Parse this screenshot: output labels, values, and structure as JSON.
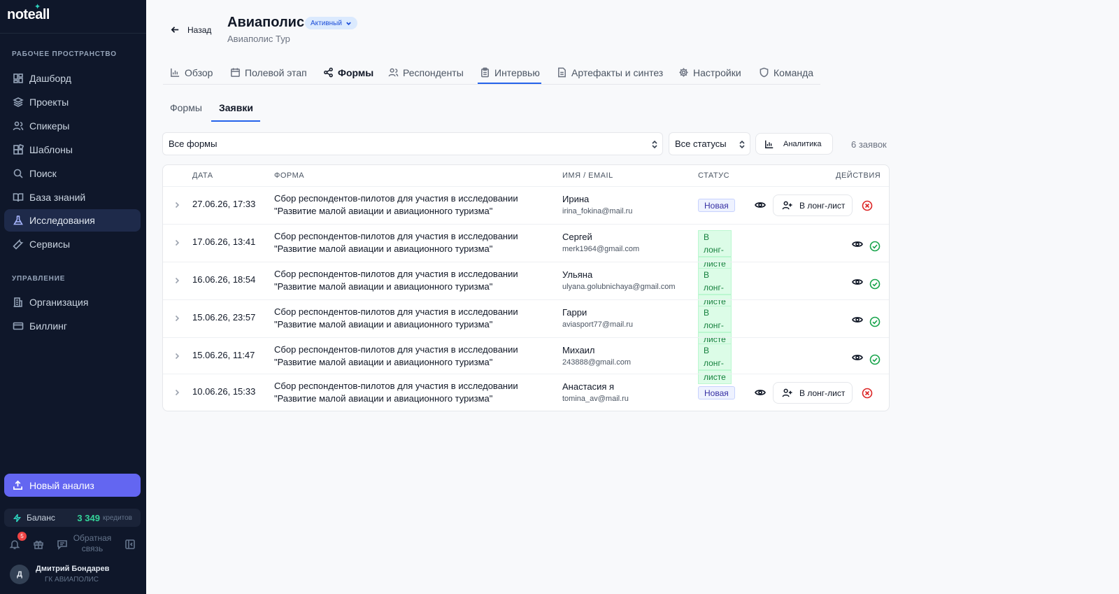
{
  "app": {
    "logo": "noteall"
  },
  "sidebar": {
    "section_workspace": "РАБОЧЕЕ ПРОСТРАНСТВО",
    "section_manage": "УПРАВЛЕНИЕ",
    "items": [
      {
        "label": "Дашборд",
        "icon": "dashboard-icon"
      },
      {
        "label": "Проекты",
        "icon": "layers-icon"
      },
      {
        "label": "Спикеры",
        "icon": "users-icon"
      },
      {
        "label": "Шаблоны",
        "icon": "blocks-icon"
      },
      {
        "label": "Поиск",
        "icon": "search-icon"
      },
      {
        "label": "База знаний",
        "icon": "book-icon"
      },
      {
        "label": "Исследования",
        "icon": "flask-icon"
      },
      {
        "label": "Сервисы",
        "icon": "wrench-icon"
      }
    ],
    "manage_items": [
      {
        "label": "Организация",
        "icon": "building-icon"
      },
      {
        "label": "Биллинг",
        "icon": "card-icon"
      }
    ],
    "new_analysis": "Новый анализ",
    "balance_label": "Баланс",
    "balance_amount": "3 349",
    "balance_unit": "кредитов",
    "notifications_count": "5",
    "feedback": "Обратная связь",
    "user_initial": "Д",
    "user_name": "Дмитрий Бондарев",
    "user_org": "ГК АВИАПОЛИС"
  },
  "header": {
    "back": "Назад",
    "title": "Авиаполис",
    "status": "Активный",
    "subtitle": "Авиаполис Тур"
  },
  "tabs": [
    {
      "label": "Обзор",
      "icon": "chart-icon"
    },
    {
      "label": "Полевой этап",
      "icon": "calendar-icon"
    },
    {
      "label": "Формы",
      "icon": "share-icon"
    },
    {
      "label": "Респонденты",
      "icon": "users-icon"
    },
    {
      "label": "Интервью",
      "icon": "clipboard-icon"
    },
    {
      "label": "Артефакты и синтез",
      "icon": "file-icon"
    },
    {
      "label": "Настройки",
      "icon": "gear-icon"
    },
    {
      "label": "Команда",
      "icon": "shield-icon"
    }
  ],
  "subtabs": {
    "forms": "Формы",
    "requests": "Заявки"
  },
  "filters": {
    "forms": "Все формы",
    "statuses": "Все статусы",
    "analytics": "Аналитика",
    "count": "6 заявок"
  },
  "table": {
    "headers": {
      "date": "ДАТА",
      "form": "ФОРМА",
      "name": "ИМЯ / EMAIL",
      "status": "СТАТУС",
      "actions": "ДЕЙСТВИЯ"
    },
    "longlist_label": "В лонг-лист",
    "rows": [
      {
        "date": "27.06.26, 17:33",
        "form_1": "Сбор респондентов-пилотов для участия в исследовании",
        "form_2": "\"Развитие малой авиации и авиационного туризма\"",
        "name": "Ирина",
        "email": "irina_fokina@mail.ru",
        "status_1": "Новая",
        "status_2": ""
      },
      {
        "date": "17.06.26, 13:41",
        "form_1": "Сбор респондентов-пилотов для участия в исследовании",
        "form_2": "\"Развитие малой авиации и авиационного туризма\"",
        "name": "Сергей",
        "email": "merk1964@gmail.com",
        "status_1": "В лонг-",
        "status_2": "листе"
      },
      {
        "date": "16.06.26, 18:54",
        "form_1": "Сбор респондентов-пилотов для участия в исследовании",
        "form_2": "\"Развитие малой авиации и авиационного туризма\"",
        "name": "Ульяна",
        "email": "ulyana.golubnichaya@gmail.com",
        "status_1": "В лонг-",
        "status_2": "листе"
      },
      {
        "date": "15.06.26, 23:57",
        "form_1": "Сбор респондентов-пилотов для участия в исследовании",
        "form_2": "\"Развитие малой авиации и авиационного туризма\"",
        "name": "Гарри",
        "email": "aviasport77@mail.ru",
        "status_1": "В лонг-",
        "status_2": "листе"
      },
      {
        "date": "15.06.26, 11:47",
        "form_1": "Сбор респондентов-пилотов для участия в исследовании",
        "form_2": "\"Развитие малой авиации и авиационного туризма\"",
        "name": "Михаил",
        "email": "243888@gmail.com",
        "status_1": "В лонг-",
        "status_2": "листе"
      },
      {
        "date": "10.06.26, 15:33",
        "form_1": "Сбор респондентов-пилотов для участия в исследовании",
        "form_2": "\"Развитие малой авиации и авиационного туризма\"",
        "name": "Анастасия я",
        "email": "tomina_av@mail.ru",
        "status_1": "Новая",
        "status_2": ""
      }
    ]
  }
}
